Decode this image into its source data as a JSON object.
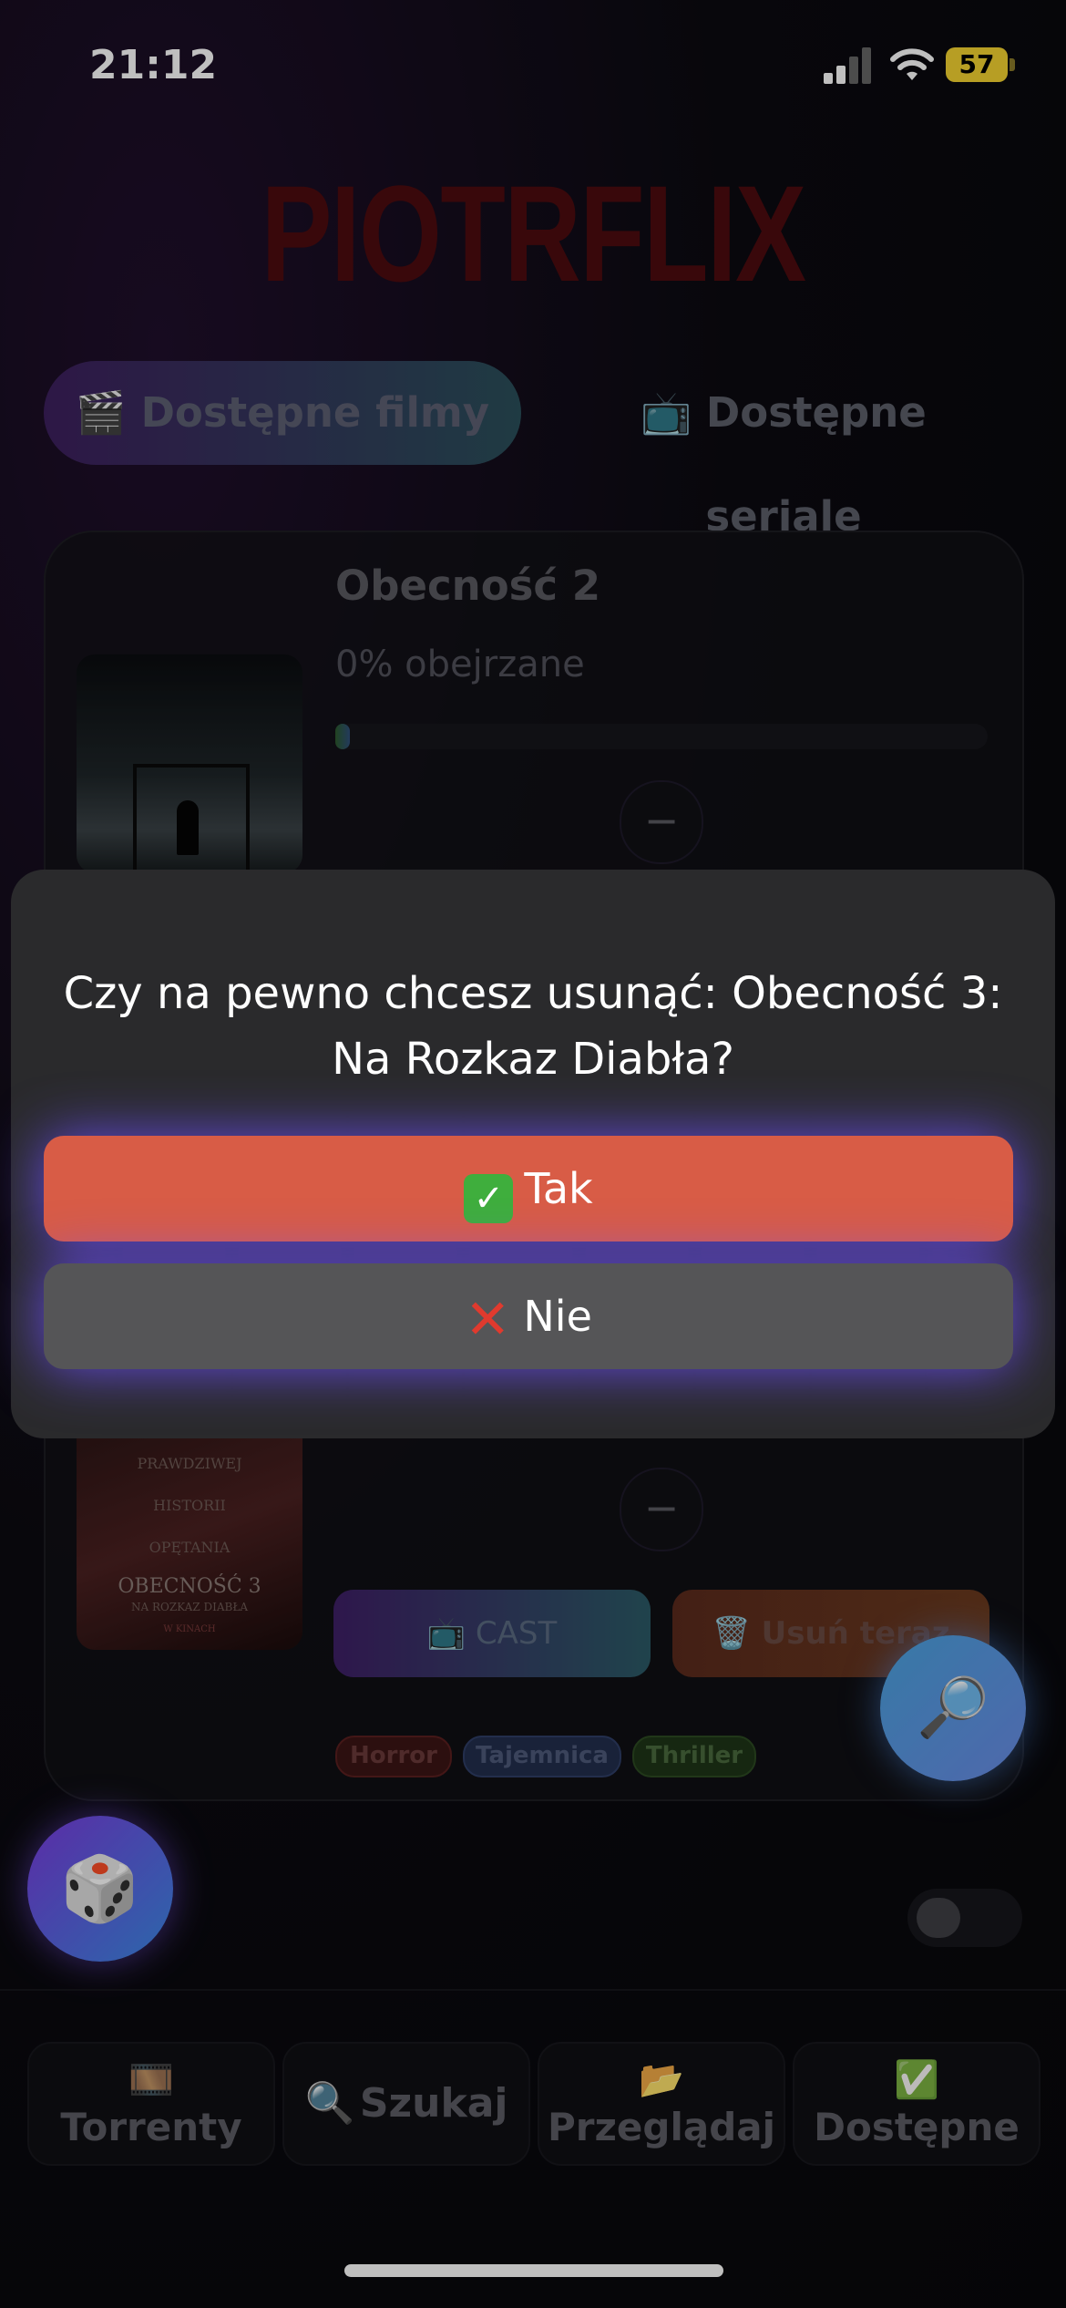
{
  "status_bar": {
    "time": "21:12",
    "battery": "57"
  },
  "app": {
    "logo": "PIOTRFLIX"
  },
  "tabs": [
    {
      "icon": "🎬",
      "label": "Dostępne filmy",
      "active": true
    },
    {
      "icon": "📺",
      "label": "Dostępne seriale",
      "active": false
    }
  ],
  "card1": {
    "title": "Obecność 2",
    "watched_label": "0% obejrzane",
    "progress": 0.0,
    "minus": "−"
  },
  "card2": {
    "poster_lines": [
      "PRAWDZIWEJ",
      "HISTORII",
      "OPĘTANIA",
      "OBECNOŚĆ 3",
      "NA ROZKAZ DIABŁA",
      "W KINACH"
    ],
    "minus": "−",
    "cast_label": "📺 CAST",
    "delete_label": "🗑️ Usuń teraz",
    "tags": [
      "Horror",
      "Tajemnica",
      "Thriller"
    ]
  },
  "dialog": {
    "message": "Czy na pewno chcesz usunąć: Obecność 3: Na Rozkaz Diabła?",
    "yes_icon": "✓",
    "yes_label": "Tak",
    "no_icon": "✕",
    "no_label": "Nie"
  },
  "fab": {
    "search_icon": "🔎",
    "dice_icon": "🎲"
  },
  "bottom_nav": [
    {
      "icon": "🎞️",
      "label": "Torrenty"
    },
    {
      "icon": "🔍",
      "label": "Szukaj"
    },
    {
      "icon": "📂",
      "label": "Przeglądaj"
    },
    {
      "icon": "✅",
      "label": "Dostępne"
    }
  ],
  "colors": {
    "accent_yes": "#d85c46",
    "accent_no": "#555557",
    "logo": "#4c0b0f",
    "glow": "#6e50ff"
  }
}
